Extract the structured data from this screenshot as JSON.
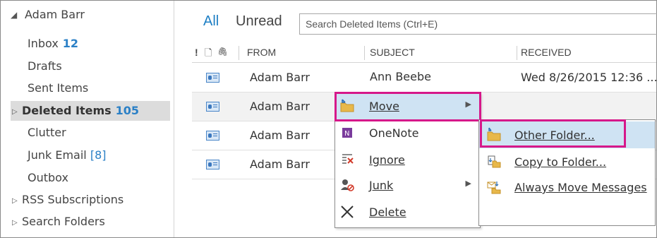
{
  "folder_pane": {
    "account": "Adam Barr",
    "folders": [
      {
        "name": "Inbox",
        "count": "12"
      },
      {
        "name": "Drafts",
        "count": ""
      },
      {
        "name": "Sent Items",
        "count": ""
      },
      {
        "name": "Deleted Items",
        "count": "105"
      },
      {
        "name": "Clutter",
        "count": ""
      },
      {
        "name": "Junk Email",
        "count": "[8]"
      },
      {
        "name": "Outbox",
        "count": ""
      },
      {
        "name": "RSS Subscriptions",
        "count": ""
      },
      {
        "name": "Search Folders",
        "count": ""
      }
    ]
  },
  "message_list": {
    "tabs": {
      "all": "All",
      "unread": "Unread"
    },
    "search_placeholder": "Search Deleted Items (Ctrl+E)",
    "columns": {
      "importance": "!",
      "icon": "🗋",
      "attachment": "🖇",
      "from": "FROM",
      "subject": "SUBJECT",
      "received": "RECEIVED"
    },
    "rows": [
      {
        "from": "Adam Barr",
        "subject": "Ann Beebe",
        "received": "Wed 8/26/2015 12:36 ..."
      },
      {
        "from": "Adam Barr",
        "subject": "",
        "received": ""
      },
      {
        "from": "Adam Barr",
        "subject": "",
        "received": ""
      },
      {
        "from": "Adam Barr",
        "subject": "",
        "received": ""
      }
    ]
  },
  "context_menu": {
    "items": [
      "Move",
      "OneNote",
      "Ignore",
      "Junk",
      "Delete"
    ]
  },
  "submenu": {
    "items": [
      "Other Folder...",
      "Copy to Folder...",
      "Always Move Messages"
    ]
  },
  "colors": {
    "accent": "#1e7fc4",
    "highlight": "#d6188a",
    "selected_bg": "#dcdcdc",
    "menu_active": "#cfe3f3"
  }
}
